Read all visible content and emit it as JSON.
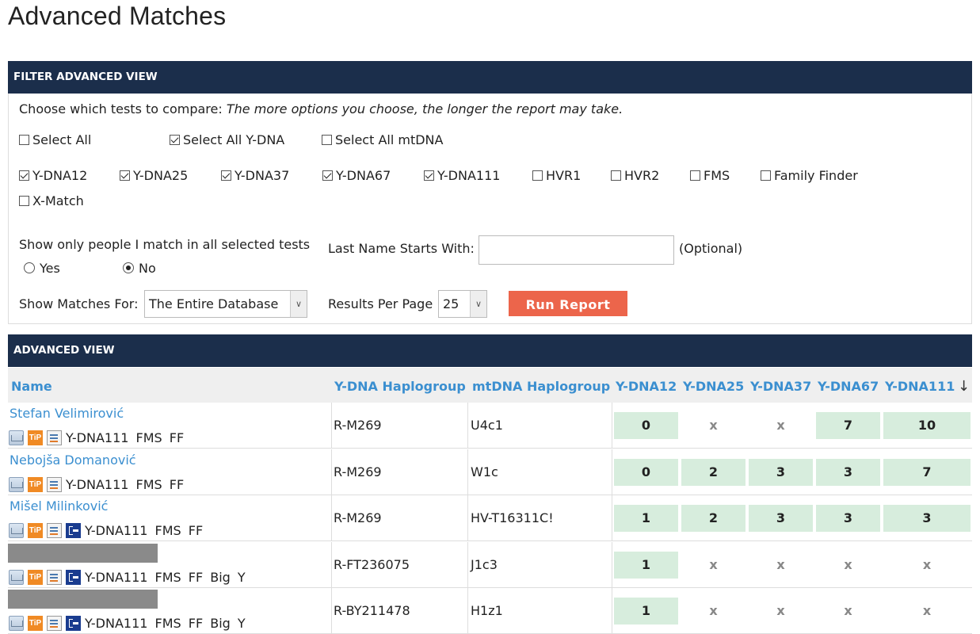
{
  "page_title": "Advanced Matches",
  "filter": {
    "header": "FILTER ADVANCED VIEW",
    "choose_label": "Choose which tests to compare:",
    "choose_note": "The more options you choose, the longer the report may take.",
    "select_all": {
      "label": "Select All",
      "checked": false
    },
    "select_all_ydna": {
      "label": "Select All Y-DNA",
      "checked": true
    },
    "select_all_mtdna": {
      "label": "Select All mtDNA",
      "checked": false
    },
    "tests": [
      {
        "label": "Y-DNA12",
        "checked": true
      },
      {
        "label": "Y-DNA25",
        "checked": true
      },
      {
        "label": "Y-DNA37",
        "checked": true
      },
      {
        "label": "Y-DNA67",
        "checked": true
      },
      {
        "label": "Y-DNA111",
        "checked": true
      },
      {
        "label": "HVR1",
        "checked": false
      },
      {
        "label": "HVR2",
        "checked": false
      },
      {
        "label": "FMS",
        "checked": false
      },
      {
        "label": "Family Finder",
        "checked": false
      },
      {
        "label": "X-Match",
        "checked": false
      }
    ],
    "show_only_label": "Show only people I match in all selected tests",
    "yes_label": "Yes",
    "no_label": "No",
    "selected_option": "No",
    "last_name_label": "Last Name Starts With:",
    "last_name_value": "",
    "optional_label": "(Optional)",
    "show_matches_label": "Show Matches For:",
    "show_matches_value": "The Entire Database",
    "results_label": "Results Per Page",
    "results_value": "25",
    "run_button": "Run Report"
  },
  "advanced": {
    "header": "ADVANCED VIEW",
    "columns": [
      "Name",
      "Y-DNA Haplogroup",
      "mtDNA Haplogroup",
      "Y-DNA12",
      "Y-DNA25",
      "Y-DNA37",
      "Y-DNA67",
      "Y-DNA111"
    ],
    "sort_indicator": "↓",
    "rows": [
      {
        "name": "Stefan Velimirović",
        "redacted": false,
        "tree": false,
        "tags": "Y-DNA111  FMS  FF",
        "ydna_hg": "R-M269",
        "mtdna_hg": "U4c1",
        "scores": [
          "0",
          "x",
          "x",
          "7",
          "10"
        ]
      },
      {
        "name": "Nebojša Domanović",
        "redacted": false,
        "tree": false,
        "tags": "Y-DNA111  FMS  FF",
        "ydna_hg": "R-M269",
        "mtdna_hg": "W1c",
        "scores": [
          "0",
          "2",
          "3",
          "3",
          "7"
        ]
      },
      {
        "name": "Mišel Milinković",
        "redacted": false,
        "tree": true,
        "tags": "Y-DNA111  FMS  FF",
        "ydna_hg": "R-M269",
        "mtdna_hg": "HV-T16311C!",
        "scores": [
          "1",
          "2",
          "3",
          "3",
          "3"
        ]
      },
      {
        "name": "",
        "redacted": true,
        "tree": true,
        "tags": "Y-DNA111  FMS  FF  Big Y",
        "ydna_hg": "R-FT236075",
        "mtdna_hg": "J1c3",
        "scores": [
          "1",
          "x",
          "x",
          "x",
          "x"
        ]
      },
      {
        "name": "",
        "redacted": true,
        "tree": true,
        "tags": "Y-DNA111  FMS  FF  Big Y",
        "ydna_hg": "R-BY211478",
        "mtdna_hg": "H1z1",
        "scores": [
          "1",
          "x",
          "x",
          "x",
          "x"
        ]
      }
    ]
  },
  "colors": {
    "header_bg": "#1b2e4b",
    "link": "#3b8fd0",
    "match_cell": "#d7eddd",
    "run_button": "#ec654b"
  }
}
